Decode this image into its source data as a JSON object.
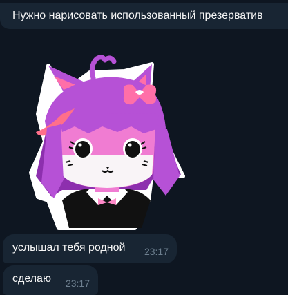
{
  "reply": {
    "text": "Нужно нарисовать использованный презерватив"
  },
  "sticker": {
    "icon": "cat-girl-sticker-icon",
    "colors": {
      "hair": "#b651d6",
      "hair_dark": "#8d2fae",
      "skin": "#f07cd2",
      "bow": "#ff6fa8",
      "outline": "#ffffff"
    }
  },
  "messages": [
    {
      "text": "услышал тебя родной",
      "time": "23:17"
    },
    {
      "text": "сделаю",
      "time": "23:17"
    }
  ],
  "theme": {
    "background": "#0e1621",
    "bubble": "#182533",
    "text": "#f5f5f5",
    "time": "#6d7f8f"
  }
}
